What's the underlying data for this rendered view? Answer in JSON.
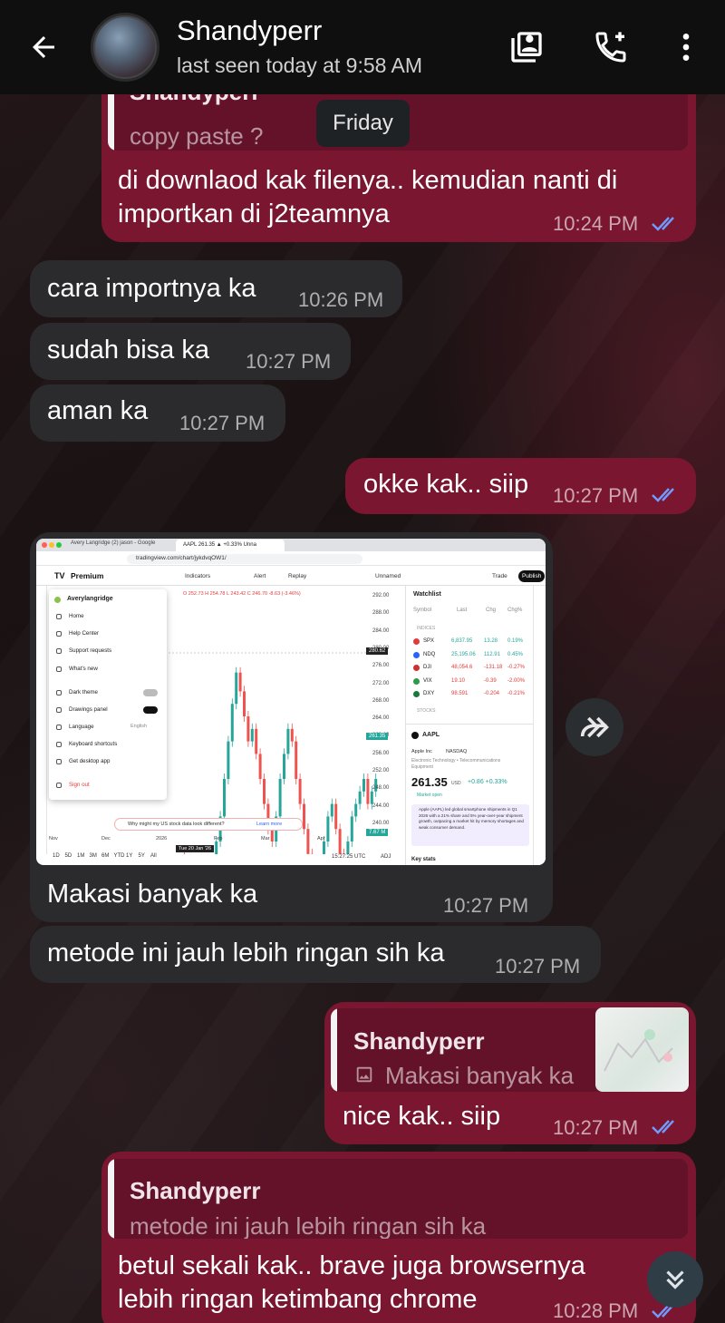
{
  "header": {
    "contact_name": "Shandyperr",
    "status": "last seen today at 9:58 AM"
  },
  "date_chip": "Friday",
  "messages": [
    {
      "reply_name": "Shandyperr",
      "reply_text": "copy paste ?",
      "line1": "di downlaod kak filenya.. kemudian nanti di",
      "line2": "importkan di j2teamnya",
      "time": "10:24 PM"
    },
    {
      "text": "cara importnya ka",
      "time": "10:26 PM"
    },
    {
      "text": "sudah bisa ka",
      "time": "10:27 PM"
    },
    {
      "text": "aman ka",
      "time": "10:27 PM"
    },
    {
      "text": "okke kak.. siip",
      "time": "10:27 PM"
    },
    {
      "caption": "Makasi banyak ka",
      "time": "10:27 PM"
    },
    {
      "text": "metode ini jauh lebih ringan sih ka",
      "time": "10:27 PM"
    },
    {
      "reply_name": "Shandyperr",
      "reply_text": "Makasi banyak ka",
      "text": "nice kak.. siip",
      "time": "10:27 PM"
    },
    {
      "reply_name": "Shandyperr",
      "reply_text": "metode ini jauh lebih ringan sih ka",
      "line1": "betul sekali kak.. brave juga browsernya",
      "line2": "lebih ringan ketimbang chrome",
      "time": "10:28 PM"
    }
  ],
  "screenshot": {
    "tab1": "Avery Langridge (2) jason - Google",
    "tab2": "AAPL 261.35 ▲ +0.33% Unna",
    "url": "tradingview.com/chart/jykdvqOW1/",
    "brand": "Premium",
    "toolbar": [
      "Indicators",
      "Alert",
      "Replay",
      "Unnamed",
      "Trade",
      "Publish"
    ],
    "ohlc": "O 252.73 H 254.78 L 243.42 C 246.70 -8.63 (-3.46%)",
    "menu_user": "Averylangridge",
    "menu": [
      "Home",
      "Help Center",
      "Support requests",
      "What's new",
      "Dark theme",
      "Drawings panel",
      "Language",
      "Keyboard shortcuts",
      "Get desktop app",
      "Sign out"
    ],
    "menu_lang_value": "English",
    "y_ticks": [
      "292.00",
      "288.00",
      "284.00",
      "280.00",
      "276.00",
      "272.00",
      "268.00",
      "264.00",
      "260.00",
      "256.00",
      "252.00",
      "248.00",
      "244.00",
      "240.00"
    ],
    "price_tag": "280.62",
    "price_tag2": "261.35",
    "x_ticks": [
      "Nov",
      "Dec",
      "2026",
      "Feb",
      "Mar",
      "Apr"
    ],
    "cursor_date": "Tue 20 Jan '26",
    "ranges": [
      "1D",
      "5D",
      "1M",
      "3M",
      "6M",
      "YTD",
      "1Y",
      "5Y",
      "All"
    ],
    "time_readout": "15:27:25 UTC",
    "adj": "ADJ",
    "notice": "Why might my US stock data look different?",
    "notice_link": "Learn more",
    "watchlist_title": "Watchlist",
    "wl_headers": [
      "Symbol",
      "Last",
      "Chg",
      "Chg%"
    ],
    "wl_section": "INDICES",
    "watchlist": [
      {
        "sym": "SPX",
        "last": "6,837.95",
        "chg": "13.28",
        "pct": "0.19%",
        "color": "#e23b3b",
        "up": true
      },
      {
        "sym": "NDQ",
        "last": "25,195.06",
        "chg": "112.91",
        "pct": "0.45%",
        "color": "#2962ff",
        "up": true
      },
      {
        "sym": "DJI",
        "last": "48,054.6",
        "chg": "-131.18",
        "pct": "-0.27%",
        "color": "#d03030",
        "up": false
      },
      {
        "sym": "VIX",
        "last": "19.10",
        "chg": "-0.39",
        "pct": "-2.00%",
        "color": "#2b9a4a",
        "up": false
      },
      {
        "sym": "DXY",
        "last": "98.591",
        "chg": "-0.204",
        "pct": "-0.21%",
        "color": "#1a7a3a",
        "up": false
      }
    ],
    "stocks_section": "STOCKS",
    "detail_symbol": "AAPL",
    "detail_name": "Apple Inc",
    "detail_exchange": "NASDAQ",
    "detail_sector": "Electronic Technology • Telecommunications Equipment",
    "detail_price": "261.35",
    "detail_currency": "USD",
    "detail_change": "+0.86  +0.33%",
    "detail_market": "Market open",
    "detail_news": "Apple (AAPL) led global smartphone shipments in Q1 2026 with a 21% share and 5% year-over-year shipment growth, outpacing a market hit by memory shortages and weak consumer demand.",
    "key_stats": "Key stats",
    "volume_tag": "7.67 M"
  },
  "colors": {
    "outgoing_bubble": "#7a1630",
    "incoming_bubble": "#2b2a2c",
    "read_check": "#6f9cff"
  },
  "icons": [
    "back-arrow-icon",
    "contact-card-icon",
    "add-call-icon",
    "more-vert-icon",
    "double-check-icon",
    "forward-icon",
    "scroll-down-icon",
    "image-icon"
  ]
}
